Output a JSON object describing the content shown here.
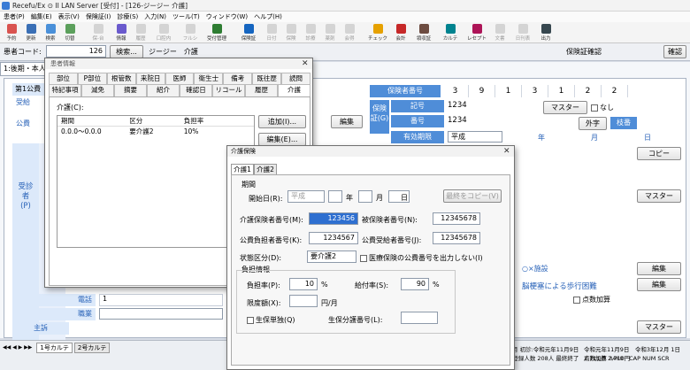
{
  "window": {
    "title": "Recefu/Ex ⊙ II LAN Server [受付] - [126-ジージー 介護]"
  },
  "menu": [
    "患者(P)",
    "編集(E)",
    "表示(V)",
    "保険証(I)",
    "診療(S)",
    "入力(N)",
    "ツール(T)",
    "ウィンドウ(W)",
    "ヘルプ(H)"
  ],
  "toolbar": [
    {
      "label": "予約",
      "icon": "calendar-icon",
      "color": "#d9534f"
    },
    {
      "label": "更新",
      "icon": "save-icon",
      "color": "#3a6fb5"
    },
    {
      "label": "検索",
      "icon": "search-icon",
      "color": "#4a90d9"
    },
    {
      "label": "切替",
      "icon": "switch-icon",
      "color": "#5ca05c"
    },
    {
      "label": "保-台",
      "icon": "ledger-icon",
      "color": "#999",
      "disabled": true
    },
    {
      "label": "情報",
      "icon": "info-icon",
      "color": "#6a5acd"
    },
    {
      "label": "履歴",
      "icon": "history-icon",
      "color": "#999",
      "disabled": true
    },
    {
      "label": "口腔内",
      "icon": "mouth-icon",
      "color": "#999",
      "disabled": true
    },
    {
      "label": "フルシ",
      "icon": "full-icon",
      "color": "#999",
      "disabled": true
    },
    {
      "label": "受付管理",
      "icon": "reception-icon",
      "color": "#2e7d32"
    },
    {
      "label": "保険証",
      "icon": "card-icon",
      "color": "#1565c0"
    },
    {
      "label": "日付",
      "icon": "date-icon",
      "color": "#999",
      "disabled": true
    },
    {
      "label": "保険",
      "icon": "insurance-icon",
      "color": "#999",
      "disabled": true
    },
    {
      "label": "診療",
      "icon": "treat-icon",
      "color": "#999",
      "disabled": true
    },
    {
      "label": "薬剤",
      "icon": "drug-icon",
      "color": "#999",
      "disabled": true
    },
    {
      "label": "会得",
      "icon": "gain-icon",
      "color": "#999",
      "disabled": true
    },
    {
      "label": "チェック",
      "icon": "check-icon",
      "color": "#e6a100"
    },
    {
      "label": "会計",
      "icon": "register-icon",
      "color": "#c62828"
    },
    {
      "label": "領収証",
      "icon": "receipt-icon",
      "color": "#6d4c41"
    },
    {
      "label": "カルテ",
      "icon": "chart-icon",
      "color": "#00838f"
    },
    {
      "label": "レセプト",
      "icon": "receipt2-icon",
      "color": "#ad1457"
    },
    {
      "label": "文書",
      "icon": "doc-icon",
      "color": "#999",
      "disabled": true
    },
    {
      "label": "日刊表",
      "icon": "daily-icon",
      "color": "#999",
      "disabled": true
    },
    {
      "label": "出力",
      "icon": "print-icon",
      "color": "#37474f"
    }
  ],
  "patient_bar": {
    "code_label": "患者コード:",
    "code_value": "126",
    "search_btn": "検索...",
    "name": "ジージー　介護",
    "insurance_confirm": "保険証確認",
    "status_btn": "確認"
  },
  "main": {
    "tab_label": "1:後期・本人",
    "row_label": "第1公費",
    "uketsuke": "受給",
    "kohi": "公費",
    "jushin": "受診者(P)",
    "phone": "電話",
    "phone_value": "1",
    "job": "職業",
    "shuso": "主訴",
    "edit": "編集"
  },
  "insurance": {
    "number_label": "保険者番号",
    "digits": [
      "3",
      "9",
      "1",
      "3",
      "1",
      "2",
      "2"
    ],
    "card_label": "保険証(G)",
    "kigo_label": "記号",
    "kigo_value": "1234",
    "bango_label": "番号",
    "bango_value": "1234",
    "valid_label": "有効期限",
    "valid_value": "平成",
    "year": "年",
    "month": "月",
    "day": "日",
    "master": "マスター",
    "nashi": "なし",
    "gaiji": "外字",
    "edaban": "枝番",
    "copy": "コピー",
    "master2": "マスター",
    "sisetsu": "○×施設",
    "address": "脳梗塞による歩行困難",
    "kasan": "点数加算",
    "edit2": "編集",
    "edit3": "編集",
    "master3": "マスター"
  },
  "kanja_info": {
    "title": "患者情報",
    "tabs_row1": [
      "部位",
      "P部位",
      "根管数",
      "来院日",
      "医師",
      "衛生士",
      "備考",
      "既往歴",
      "読問"
    ],
    "tabs_row2": [
      "特記事項",
      "減免",
      "摘要",
      "紹介",
      "確認日",
      "リコール",
      "履歴",
      "介護"
    ],
    "section": "介護(C):",
    "cols": [
      "期間",
      "区分",
      "負担率"
    ],
    "rows": [
      {
        "period": "0.0.0～0.0.0",
        "kubun": "要介護2",
        "rate": "10%"
      }
    ],
    "add_btn": "追加(I)...",
    "edit_btn": "編集(E)..."
  },
  "kaigo_dialog": {
    "title": "介護保険",
    "tabs": [
      "介護1",
      "介護2"
    ],
    "kikan_label": "期間",
    "start_label": "開始日(R):",
    "era": "平成",
    "nen": "年",
    "tsuki": "月",
    "hi": "日",
    "copy_btn": "最終をコピー(V)",
    "hoken_no_label": "介護保険者番号(M):",
    "hoken_no": "123456",
    "hihoken_label": "被保険者番号(N):",
    "hihoken_no": "12345678",
    "kohi_futan_label": "公費負担者番号(K):",
    "kohi_futan_no": "1234567",
    "kohi_jukyu_label": "公費受給者番号(J):",
    "kohi_jukyu_no": "12345678",
    "jotai_label": "状態区分(D):",
    "jotai_value": "要介護2",
    "iryo_label": "医療保険の公費番号を出力しない(I)",
    "futan_label": "負担情報",
    "futan_rate_label": "負担率(P):",
    "futan_rate": "10",
    "percent": "%",
    "kyufu_label": "給付率(S):",
    "kyufu_rate": "90",
    "gendo_label": "限度額(X):",
    "yen": "円/月",
    "seiho_label": "生保単独(Q)",
    "seiho_no_label": "生保分護番号(L):"
  },
  "bottom_tabs": [
    "1号カルテ",
    "2号カルテ"
  ],
  "status": {
    "line1": "令和元年11月9日　令和3年12月 1日　2,711点 2,710円",
    "line1_prefix": "97才10月 初診:令和元年11月9日",
    "line2_prefix": "月28日 登録人数 208人 最終終了",
    "line2": "点数加算 3460　CAP NUM SCR"
  }
}
